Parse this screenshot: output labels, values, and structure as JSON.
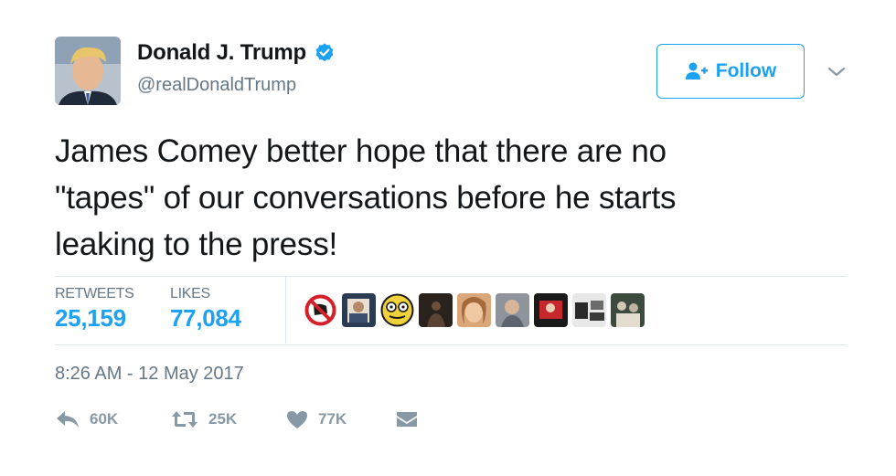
{
  "author": {
    "name": "Donald J. Trump",
    "handle": "@realDonaldTrump",
    "verified": true
  },
  "follow": {
    "label": "Follow"
  },
  "tweet": {
    "text_lines": [
      "James Comey better hope that there are no",
      "\"tapes\" of our conversations before he starts",
      "leaking to the press!"
    ]
  },
  "stats": {
    "retweets_label": "RETWEETS",
    "retweets_value": "25,159",
    "likes_label": "LIKES",
    "likes_value": "77,084"
  },
  "timestamp": "8:26 AM - 12 May 2017",
  "actions": {
    "reply_count": "60K",
    "retweet_count": "25K",
    "like_count": "77K"
  },
  "colors": {
    "accent": "#1da1f2",
    "muted": "#657786",
    "action_gray": "#8899a6"
  }
}
